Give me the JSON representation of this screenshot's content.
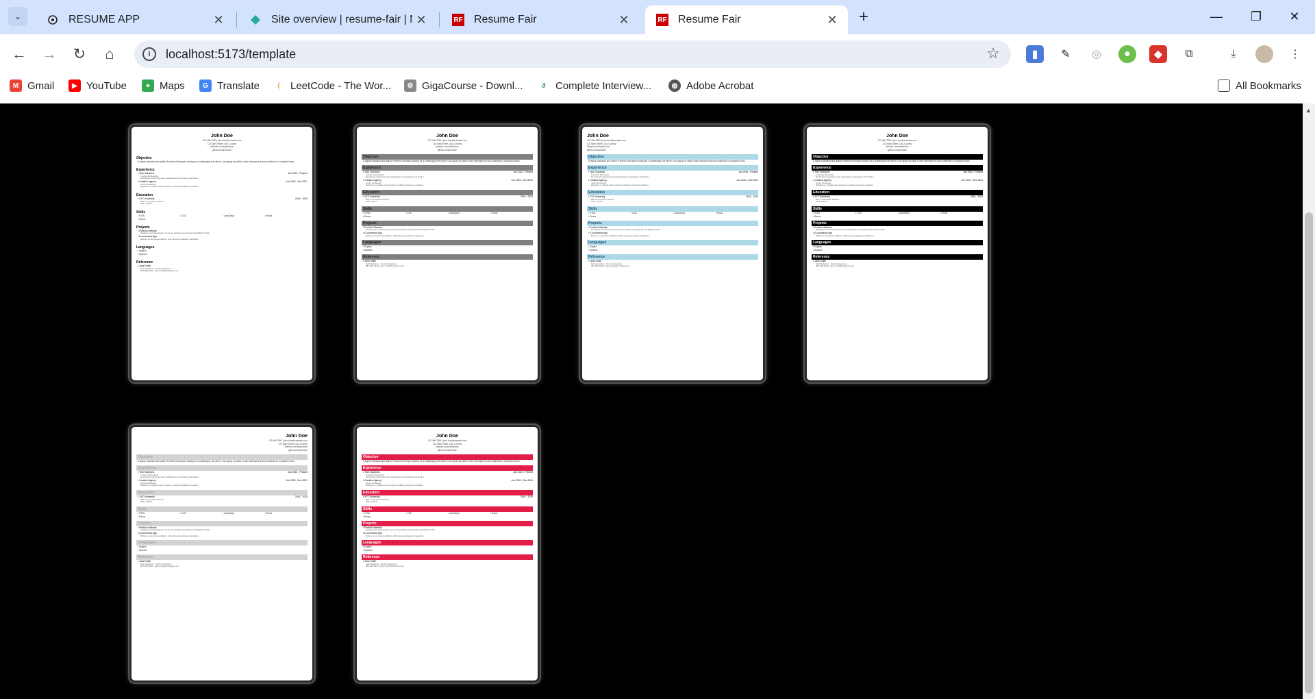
{
  "browser": {
    "tabs": [
      {
        "title": "RESUME APP",
        "icon": "openai-icon"
      },
      {
        "title": "Site overview | resume-fair | Net",
        "icon": "netlify-icon"
      },
      {
        "title": "Resume Fair",
        "icon": "rf-icon"
      },
      {
        "title": "Resume Fair",
        "icon": "rf-icon"
      }
    ],
    "active_tab": 3,
    "url": "localhost:5173/template",
    "bookmarks": [
      {
        "label": "Gmail",
        "icon": "gmail-icon"
      },
      {
        "label": "YouTube",
        "icon": "youtube-icon"
      },
      {
        "label": "Maps",
        "icon": "maps-icon"
      },
      {
        "label": "Translate",
        "icon": "translate-icon"
      },
      {
        "label": "LeetCode - The Wor...",
        "icon": "leetcode-icon"
      },
      {
        "label": "GigaCourse - Downl...",
        "icon": "gigacourse-icon"
      },
      {
        "label": "Complete Interview...",
        "icon": "geeksforgeeks-icon"
      },
      {
        "label": "Adobe Acrobat",
        "icon": "globe-icon"
      }
    ],
    "all_bookmarks": "All Bookmarks"
  },
  "resume": {
    "name": "John Doe",
    "phone": "123-456-7890",
    "email": "john.doe@example.com",
    "address": "123 Main Street, City, Country",
    "linkedin": "linkedin.com/in/johndoe",
    "github": "github.com/johndoe",
    "objective_title": "Objective",
    "objective": "A highly motivated and skilled Frontend Developer looking for a challenging role where I can apply my skills in web development and contribute to a dynamic team.",
    "experience_title": "Experience",
    "exp1_company": "Tech Solutions",
    "exp1_dates": "Jan 2022 - Present",
    "exp1_role": "Frontend Developer",
    "exp1_desc": "Developed responsive web applications using React and Redux.",
    "exp2_company": "Creative Agency",
    "exp2_dates": "Jun 2020 - Dec 2021",
    "exp2_role": "Junior Developer",
    "exp2_desc": "Worked on multiple client projects, building interactive websites.",
    "education_title": "Education",
    "edu_school": "XYZ University",
    "edu_dates": "2016 - 2020",
    "edu_degree": "BSc in Computer Science",
    "edu_gpa": "GPA: 3.8/4.0",
    "skills_title": "Skills",
    "skill1": "HTML",
    "skill2": "CSS",
    "skill3": "JavaScript",
    "skill4": "React",
    "skill5": "Redux",
    "projects_title": "Projects",
    "proj1_name": "Portfolio Website",
    "proj1_desc": "Designed and developed a personal portfolio using React and Tailwind CSS.",
    "proj2_name": "E-commerce App",
    "proj2_desc": "Built an e-commerce platform with payment gateway integration.",
    "languages_title": "Languages",
    "lang1": "English",
    "lang2": "Spanish",
    "reference_title": "Reference",
    "ref_name": "Jane Smith",
    "ref_role": "Tech Solutions - Senior Developer",
    "ref_contact": "987-654-3210 - jane.smith@example.com"
  },
  "templates": [
    {
      "style": "plain"
    },
    {
      "style": "gray"
    },
    {
      "style": "light-blue"
    },
    {
      "style": "black"
    },
    {
      "style": "light-gray"
    },
    {
      "style": "crimson"
    }
  ],
  "colors": {
    "tabbar_bg": "#d3e3fd",
    "page_bg": "#000000",
    "template_gray": "#808080",
    "template_blue": "#add8e6",
    "template_black": "#000000",
    "template_light": "#d3d3d3",
    "template_red": "#e11d48"
  }
}
